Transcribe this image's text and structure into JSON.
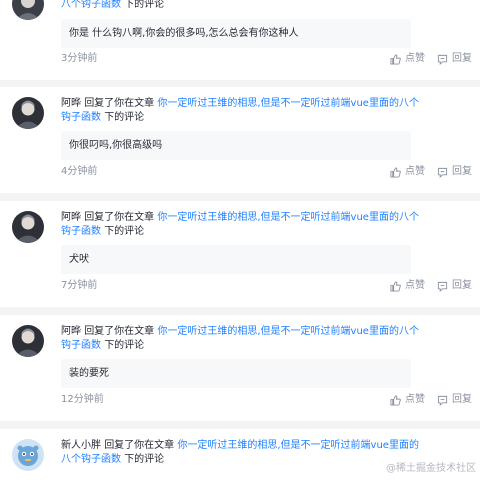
{
  "notifications": [
    {
      "user": "",
      "action": "",
      "article": "八个钩子函数",
      "suffix": "下的评论",
      "content": "你是 什么钩八啊,你会的很多吗,怎么总会有你这种人",
      "time": "3分钟前",
      "like_label": "点赞",
      "reply_label": "回复"
    },
    {
      "user": "阿晔",
      "action": "回复了你在文章",
      "article": "你一定听过王维的相思,但是不一定听过前端vue里面的八个钩子函数",
      "suffix": "下的评论",
      "content": "你很叼吗,你很高级吗",
      "time": "4分钟前",
      "like_label": "点赞",
      "reply_label": "回复"
    },
    {
      "user": "阿晔",
      "action": "回复了你在文章",
      "article": "你一定听过王维的相思,但是不一定听过前端vue里面的八个钩子函数",
      "suffix": "下的评论",
      "content": "犬吠",
      "time": "7分钟前",
      "like_label": "点赞",
      "reply_label": "回复"
    },
    {
      "user": "阿晔",
      "action": "回复了你在文章",
      "article": "你一定听过王维的相思,但是不一定听过前端vue里面的八个钩子函数",
      "suffix": "下的评论",
      "content": "装的要死",
      "time": "12分钟前",
      "like_label": "点赞",
      "reply_label": "回复"
    },
    {
      "user": "新人小胖",
      "action": "回复了你在文章",
      "article": "你一定听过王维的相思,但是不一定听过前端vue里面的八个钩子函数",
      "suffix": "下的评论"
    }
  ],
  "watermark": "@稀土掘金技术社区",
  "colors": {
    "link": "#1e80ff",
    "muted": "#8a919f",
    "quote_bg": "#f7f8fa",
    "page_bg": "#f2f3f5"
  }
}
